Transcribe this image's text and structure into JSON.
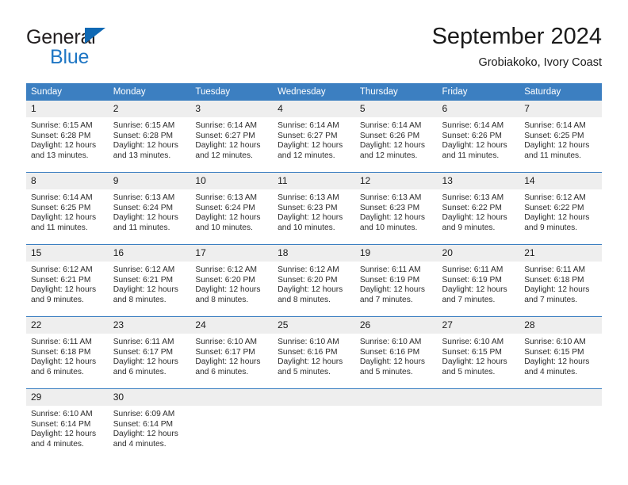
{
  "brand": {
    "word1": "General",
    "word2": "Blue",
    "triangle_color": "#1069b4",
    "word2_color": "#1e76c4"
  },
  "header": {
    "title": "September 2024",
    "subtitle": "Grobiakoko, Ivory Coast"
  },
  "theme": {
    "header_bg": "#3c7fc1",
    "daynum_bg": "#eeeeee",
    "row_divider": "#3c7fc1"
  },
  "calendar": {
    "weekday_headers": [
      "Sunday",
      "Monday",
      "Tuesday",
      "Wednesday",
      "Thursday",
      "Friday",
      "Saturday"
    ],
    "weeks": [
      [
        {
          "day": "1",
          "sunrise": "Sunrise: 6:15 AM",
          "sunset": "Sunset: 6:28 PM",
          "daylight_line1": "Daylight: 12 hours",
          "daylight_line2": "and 13 minutes."
        },
        {
          "day": "2",
          "sunrise": "Sunrise: 6:15 AM",
          "sunset": "Sunset: 6:28 PM",
          "daylight_line1": "Daylight: 12 hours",
          "daylight_line2": "and 13 minutes."
        },
        {
          "day": "3",
          "sunrise": "Sunrise: 6:14 AM",
          "sunset": "Sunset: 6:27 PM",
          "daylight_line1": "Daylight: 12 hours",
          "daylight_line2": "and 12 minutes."
        },
        {
          "day": "4",
          "sunrise": "Sunrise: 6:14 AM",
          "sunset": "Sunset: 6:27 PM",
          "daylight_line1": "Daylight: 12 hours",
          "daylight_line2": "and 12 minutes."
        },
        {
          "day": "5",
          "sunrise": "Sunrise: 6:14 AM",
          "sunset": "Sunset: 6:26 PM",
          "daylight_line1": "Daylight: 12 hours",
          "daylight_line2": "and 12 minutes."
        },
        {
          "day": "6",
          "sunrise": "Sunrise: 6:14 AM",
          "sunset": "Sunset: 6:26 PM",
          "daylight_line1": "Daylight: 12 hours",
          "daylight_line2": "and 11 minutes."
        },
        {
          "day": "7",
          "sunrise": "Sunrise: 6:14 AM",
          "sunset": "Sunset: 6:25 PM",
          "daylight_line1": "Daylight: 12 hours",
          "daylight_line2": "and 11 minutes."
        }
      ],
      [
        {
          "day": "8",
          "sunrise": "Sunrise: 6:14 AM",
          "sunset": "Sunset: 6:25 PM",
          "daylight_line1": "Daylight: 12 hours",
          "daylight_line2": "and 11 minutes."
        },
        {
          "day": "9",
          "sunrise": "Sunrise: 6:13 AM",
          "sunset": "Sunset: 6:24 PM",
          "daylight_line1": "Daylight: 12 hours",
          "daylight_line2": "and 11 minutes."
        },
        {
          "day": "10",
          "sunrise": "Sunrise: 6:13 AM",
          "sunset": "Sunset: 6:24 PM",
          "daylight_line1": "Daylight: 12 hours",
          "daylight_line2": "and 10 minutes."
        },
        {
          "day": "11",
          "sunrise": "Sunrise: 6:13 AM",
          "sunset": "Sunset: 6:23 PM",
          "daylight_line1": "Daylight: 12 hours",
          "daylight_line2": "and 10 minutes."
        },
        {
          "day": "12",
          "sunrise": "Sunrise: 6:13 AM",
          "sunset": "Sunset: 6:23 PM",
          "daylight_line1": "Daylight: 12 hours",
          "daylight_line2": "and 10 minutes."
        },
        {
          "day": "13",
          "sunrise": "Sunrise: 6:13 AM",
          "sunset": "Sunset: 6:22 PM",
          "daylight_line1": "Daylight: 12 hours",
          "daylight_line2": "and 9 minutes."
        },
        {
          "day": "14",
          "sunrise": "Sunrise: 6:12 AM",
          "sunset": "Sunset: 6:22 PM",
          "daylight_line1": "Daylight: 12 hours",
          "daylight_line2": "and 9 minutes."
        }
      ],
      [
        {
          "day": "15",
          "sunrise": "Sunrise: 6:12 AM",
          "sunset": "Sunset: 6:21 PM",
          "daylight_line1": "Daylight: 12 hours",
          "daylight_line2": "and 9 minutes."
        },
        {
          "day": "16",
          "sunrise": "Sunrise: 6:12 AM",
          "sunset": "Sunset: 6:21 PM",
          "daylight_line1": "Daylight: 12 hours",
          "daylight_line2": "and 8 minutes."
        },
        {
          "day": "17",
          "sunrise": "Sunrise: 6:12 AM",
          "sunset": "Sunset: 6:20 PM",
          "daylight_line1": "Daylight: 12 hours",
          "daylight_line2": "and 8 minutes."
        },
        {
          "day": "18",
          "sunrise": "Sunrise: 6:12 AM",
          "sunset": "Sunset: 6:20 PM",
          "daylight_line1": "Daylight: 12 hours",
          "daylight_line2": "and 8 minutes."
        },
        {
          "day": "19",
          "sunrise": "Sunrise: 6:11 AM",
          "sunset": "Sunset: 6:19 PM",
          "daylight_line1": "Daylight: 12 hours",
          "daylight_line2": "and 7 minutes."
        },
        {
          "day": "20",
          "sunrise": "Sunrise: 6:11 AM",
          "sunset": "Sunset: 6:19 PM",
          "daylight_line1": "Daylight: 12 hours",
          "daylight_line2": "and 7 minutes."
        },
        {
          "day": "21",
          "sunrise": "Sunrise: 6:11 AM",
          "sunset": "Sunset: 6:18 PM",
          "daylight_line1": "Daylight: 12 hours",
          "daylight_line2": "and 7 minutes."
        }
      ],
      [
        {
          "day": "22",
          "sunrise": "Sunrise: 6:11 AM",
          "sunset": "Sunset: 6:18 PM",
          "daylight_line1": "Daylight: 12 hours",
          "daylight_line2": "and 6 minutes."
        },
        {
          "day": "23",
          "sunrise": "Sunrise: 6:11 AM",
          "sunset": "Sunset: 6:17 PM",
          "daylight_line1": "Daylight: 12 hours",
          "daylight_line2": "and 6 minutes."
        },
        {
          "day": "24",
          "sunrise": "Sunrise: 6:10 AM",
          "sunset": "Sunset: 6:17 PM",
          "daylight_line1": "Daylight: 12 hours",
          "daylight_line2": "and 6 minutes."
        },
        {
          "day": "25",
          "sunrise": "Sunrise: 6:10 AM",
          "sunset": "Sunset: 6:16 PM",
          "daylight_line1": "Daylight: 12 hours",
          "daylight_line2": "and 5 minutes."
        },
        {
          "day": "26",
          "sunrise": "Sunrise: 6:10 AM",
          "sunset": "Sunset: 6:16 PM",
          "daylight_line1": "Daylight: 12 hours",
          "daylight_line2": "and 5 minutes."
        },
        {
          "day": "27",
          "sunrise": "Sunrise: 6:10 AM",
          "sunset": "Sunset: 6:15 PM",
          "daylight_line1": "Daylight: 12 hours",
          "daylight_line2": "and 5 minutes."
        },
        {
          "day": "28",
          "sunrise": "Sunrise: 6:10 AM",
          "sunset": "Sunset: 6:15 PM",
          "daylight_line1": "Daylight: 12 hours",
          "daylight_line2": "and 4 minutes."
        }
      ],
      [
        {
          "day": "29",
          "sunrise": "Sunrise: 6:10 AM",
          "sunset": "Sunset: 6:14 PM",
          "daylight_line1": "Daylight: 12 hours",
          "daylight_line2": "and 4 minutes."
        },
        {
          "day": "30",
          "sunrise": "Sunrise: 6:09 AM",
          "sunset": "Sunset: 6:14 PM",
          "daylight_line1": "Daylight: 12 hours",
          "daylight_line2": "and 4 minutes."
        },
        {
          "day": "",
          "sunrise": "",
          "sunset": "",
          "daylight_line1": "",
          "daylight_line2": ""
        },
        {
          "day": "",
          "sunrise": "",
          "sunset": "",
          "daylight_line1": "",
          "daylight_line2": ""
        },
        {
          "day": "",
          "sunrise": "",
          "sunset": "",
          "daylight_line1": "",
          "daylight_line2": ""
        },
        {
          "day": "",
          "sunrise": "",
          "sunset": "",
          "daylight_line1": "",
          "daylight_line2": ""
        },
        {
          "day": "",
          "sunrise": "",
          "sunset": "",
          "daylight_line1": "",
          "daylight_line2": ""
        }
      ]
    ]
  }
}
